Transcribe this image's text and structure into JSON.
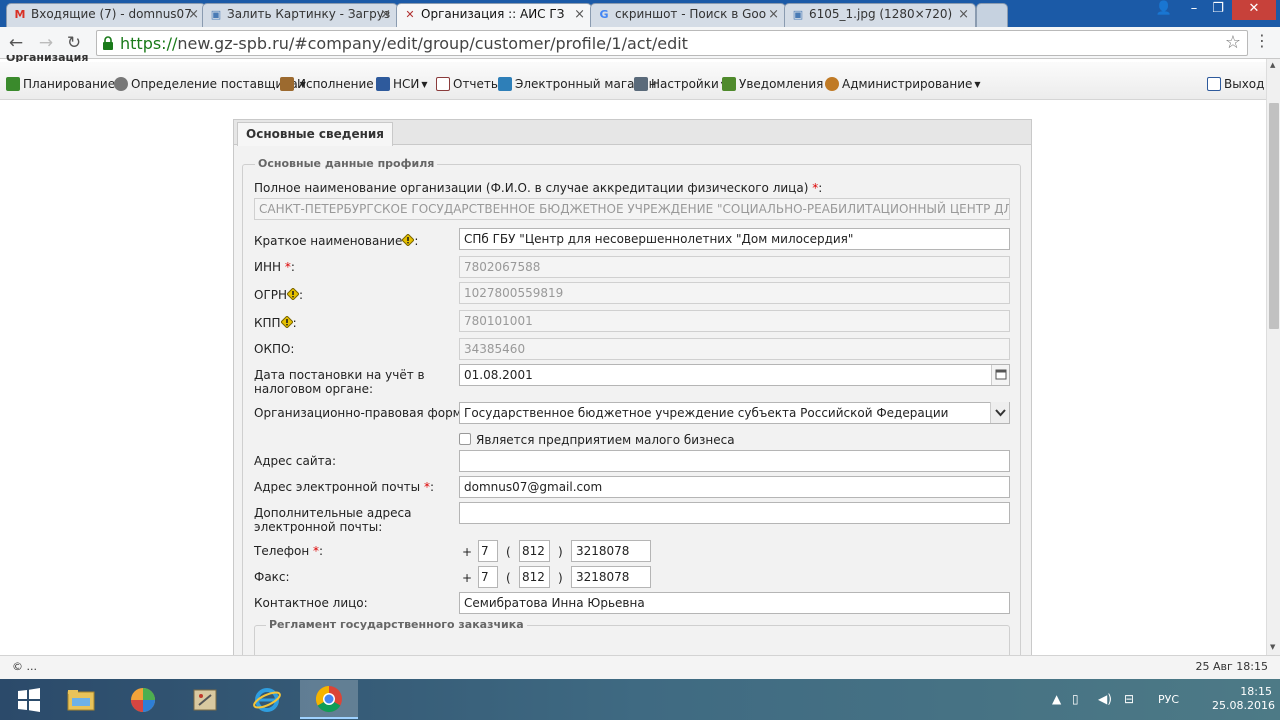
{
  "browser": {
    "tabs": [
      {
        "label": "Входящие (7) - domnus07",
        "icon": "gmail-icon",
        "active": false
      },
      {
        "label": "Залить Картинку - Загруз",
        "icon": "image-host-icon",
        "active": false
      },
      {
        "label": "Организация :: АИС ГЗ",
        "icon": "tools-icon",
        "active": true
      },
      {
        "label": "скриншот - Поиск в Goo",
        "icon": "google-icon",
        "active": false
      },
      {
        "label": "6105_1.jpg (1280×720)",
        "icon": "image-icon",
        "active": false
      }
    ],
    "url_secure": "https://",
    "url_rest": "new.gz-spb.ru/#company/edit/group/customer/profile/1/act/edit"
  },
  "app": {
    "cut_title": "Организация",
    "menu": [
      {
        "label": "Планирование",
        "icon": "planning-icon",
        "dropdown": true,
        "color": "#3a8a2c"
      },
      {
        "label": "Определение поставщика",
        "icon": "gear-icon",
        "dropdown": true,
        "color": "#666666"
      },
      {
        "label": "Исполнение",
        "icon": "contract-icon",
        "dropdown": true,
        "color": "#9c6a2f"
      },
      {
        "label": "НСИ",
        "icon": "book-icon",
        "dropdown": true,
        "color": "#2e5a9c"
      },
      {
        "label": "Отчеты",
        "icon": "report-icon",
        "dropdown": false,
        "color": "#8a3b3b"
      },
      {
        "label": "Электронный магазин",
        "icon": "cart-icon",
        "dropdown": false,
        "color": "#2e7fb8"
      },
      {
        "label": "Настройки",
        "icon": "wrench-icon",
        "dropdown": true,
        "color": "#5a6a7a"
      },
      {
        "label": "Уведомления",
        "icon": "notification-icon",
        "dropdown": true,
        "color": "#4f8a2c"
      },
      {
        "label": "Администрирование",
        "icon": "admin-user-icon",
        "dropdown": true,
        "color": "#c07a25"
      }
    ],
    "exit_label": "Выход"
  },
  "form": {
    "tab": "Основные сведения",
    "legend": "Основные данные профиля",
    "full_name_label": "Полное наименование организации (Ф.И.О. в случае аккредитации физического лица)",
    "full_name_value": "САНКТ-ПЕТЕРБУРГСКОЕ ГОСУДАРСТВЕННОЕ БЮДЖЕТНОЕ УЧРЕЖДЕНИЕ \"СОЦИАЛЬНО-РЕАБИЛИТАЦИОННЫЙ ЦЕНТР ДЛЯ НЕСОВЕРШЕ",
    "short_name_label": "Краткое наименование",
    "short_name_value": "СПб ГБУ \"Центр для несовершеннолетних \"Дом милосердия\"",
    "inn_label": "ИНН",
    "inn_value": "7802067588",
    "ogrn_label": "ОГРН",
    "ogrn_value": "1027800559819",
    "kpp_label": "КПП",
    "kpp_value": "780101001",
    "okpo_label": "ОКПО:",
    "okpo_value": "34385460",
    "tax_date_label_1": "Дата постановки на учёт в",
    "tax_date_label_2": "налоговом органе:",
    "tax_date_value": "01.08.2001",
    "legal_form_label": "Организационно-правовая форма:",
    "legal_form_value": "Государственное бюджетное учреждение субъекта Российской Федерации",
    "small_business_label": "Является предприятием малого бизнеса",
    "website_label": "Адрес сайта:",
    "website_value": "",
    "email_label": "Адрес электронной почты",
    "email_value": "domnus07@gmail.com",
    "extra_email_label_1": "Дополнительные адреса",
    "extra_email_label_2": "электронной почты:",
    "extra_email_value": "",
    "phone_label": "Телефон",
    "phone_country": "7",
    "phone_code": "812",
    "phone_number": "3218078",
    "fax_label": "Факс:",
    "fax_country": "7",
    "fax_code": "812",
    "fax_number": "3218078",
    "contact_label": "Контактное лицо:",
    "contact_value": "Семибратова Инна Юрьевна",
    "regulation_legend": "Регламент государственного заказчика"
  },
  "status": {
    "left": "© ...",
    "right": "25 Авг 18:15"
  },
  "taskbar": {
    "lang": "РУС",
    "time": "18:15",
    "date": "25.08.2016"
  }
}
